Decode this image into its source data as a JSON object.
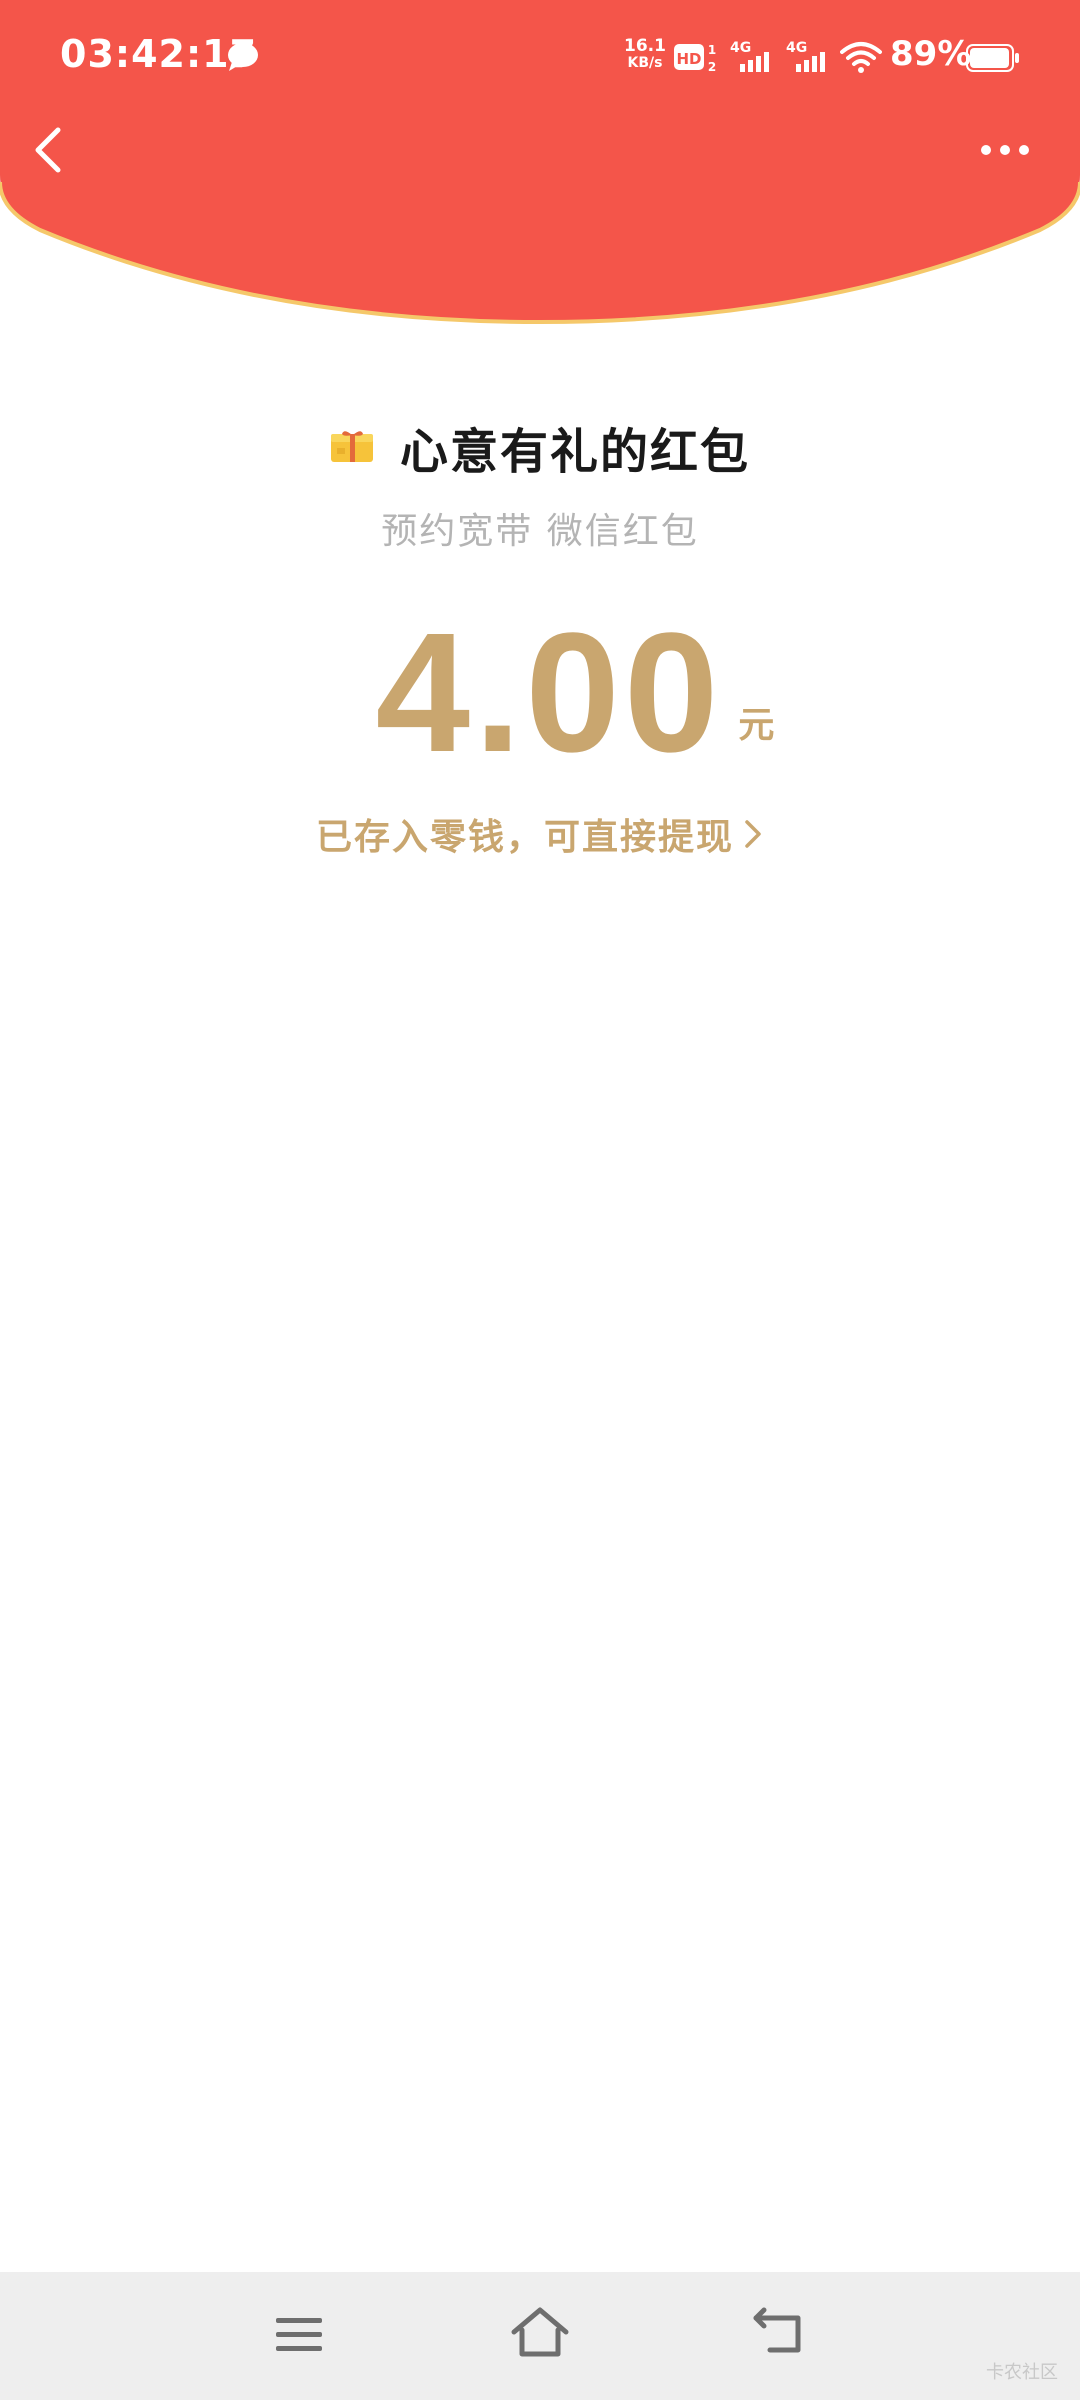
{
  "status_bar": {
    "time": "03:42:17",
    "net_speed_value": "16.1",
    "net_speed_unit": "KB/s",
    "signal_1_label": "4G",
    "signal_2_label": "4G",
    "battery_percent": "89%"
  },
  "envelope": {
    "title": "心意有礼的红包",
    "subtitle": "预约宽带 微信红包",
    "amount": "4.00",
    "currency_unit": "元",
    "stored_message": "已存入零钱，可直接提现"
  },
  "watermark": "卡农社区",
  "colors": {
    "header_red": "#f4554a",
    "header_arc_edge": "#f5c86a",
    "gold": "#c9a66f",
    "subtitle_gray": "#b4b4b4",
    "nav_bar_bg": "#eeeeee"
  },
  "icons": {
    "back": "chevron-left-icon",
    "more": "more-dots-icon",
    "gift": "gift-box-icon",
    "link": "chevron-right-icon",
    "nav_menu": "menu-icon",
    "nav_home": "home-icon",
    "nav_back": "back-icon"
  }
}
